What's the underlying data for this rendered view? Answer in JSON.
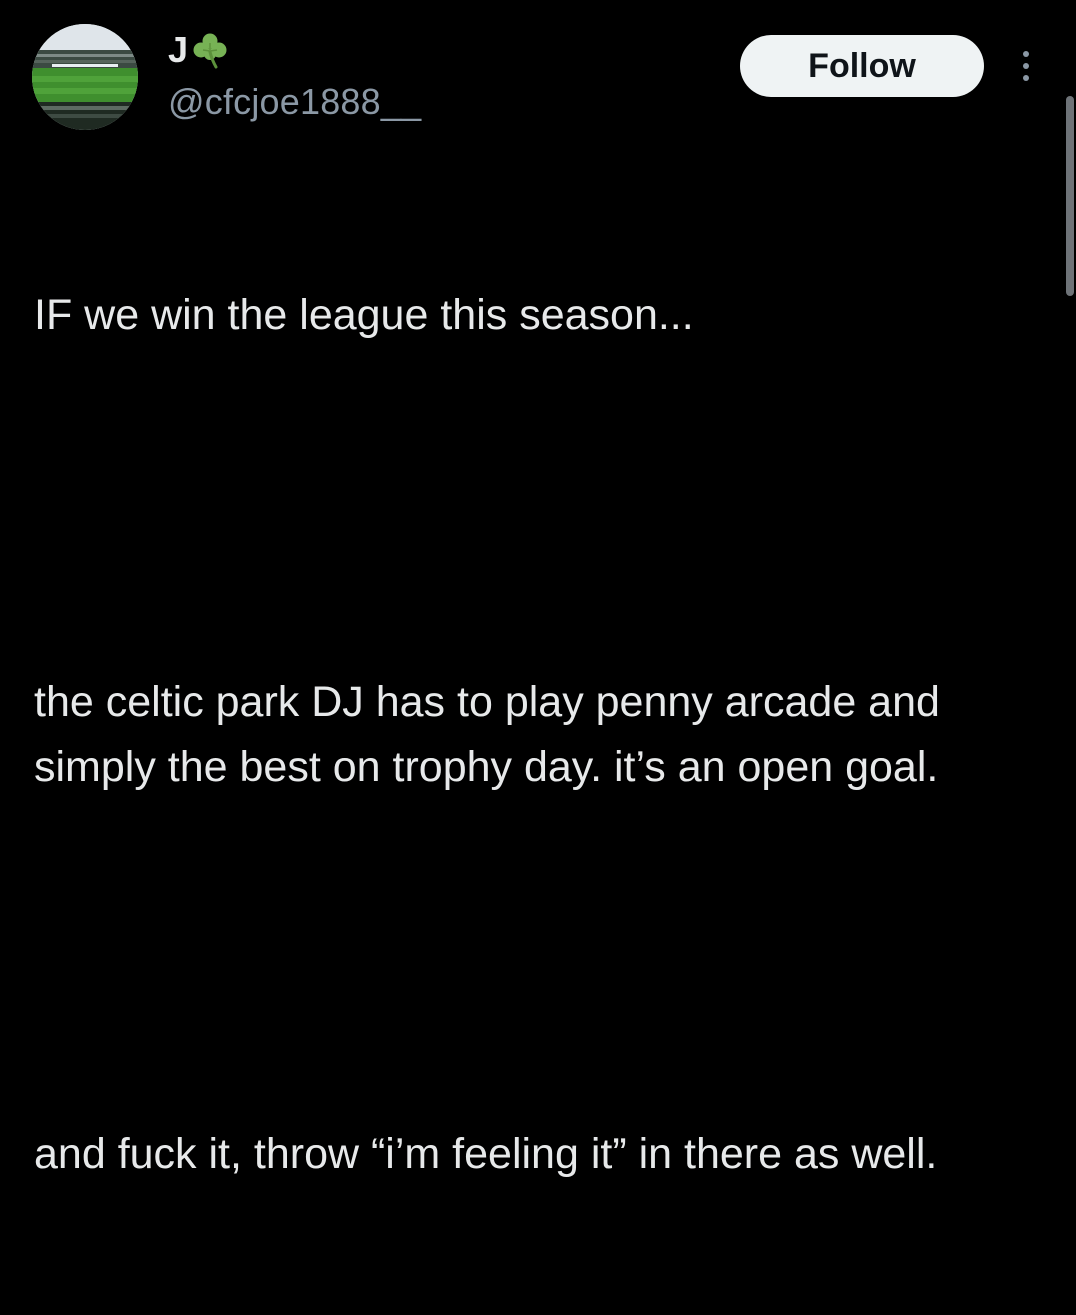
{
  "author": {
    "display_name": "J",
    "display_name_emoji": "shamrock-icon",
    "handle": "@cfcjoe1888__",
    "avatar_icon": "stadium-avatar"
  },
  "actions": {
    "follow_label": "Follow",
    "more_icon": "more-vertical-icon"
  },
  "tweet": {
    "paragraphs": [
      "IF we win the league this season...",
      "the celtic park DJ has to play penny arcade and simply the best on trophy day. it’s an open goal.",
      "and fuck it, throw “i’m feeling it” in there as well."
    ]
  },
  "colors": {
    "background": "#000000",
    "text_primary": "#e7e9ea",
    "text_secondary": "#8b98a5",
    "button_bg": "#eff3f4",
    "button_text": "#0f1419"
  }
}
